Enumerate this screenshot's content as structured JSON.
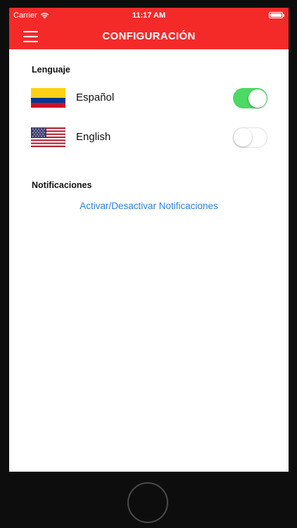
{
  "status_bar": {
    "carrier": "Carrier",
    "time": "11:17 AM",
    "wifi_icon": "wifi-icon",
    "battery_icon": "battery-icon"
  },
  "nav": {
    "title": "CONFIGURACIÓN",
    "menu_icon": "hamburger-menu-icon",
    "background_color": "#f42a29"
  },
  "language_section": {
    "title": "Lenguaje",
    "options": [
      {
        "label": "Español",
        "flag": "colombia-flag-icon",
        "enabled": true
      },
      {
        "label": "English",
        "flag": "usa-flag-icon",
        "enabled": false
      }
    ]
  },
  "notifications_section": {
    "title": "Notificaciones",
    "link_label": "Activar/Desactivar Notificaciones",
    "link_color": "#2d7fe0"
  },
  "colors": {
    "toggle_on": "#4cd964",
    "accent_red": "#f42a29"
  }
}
